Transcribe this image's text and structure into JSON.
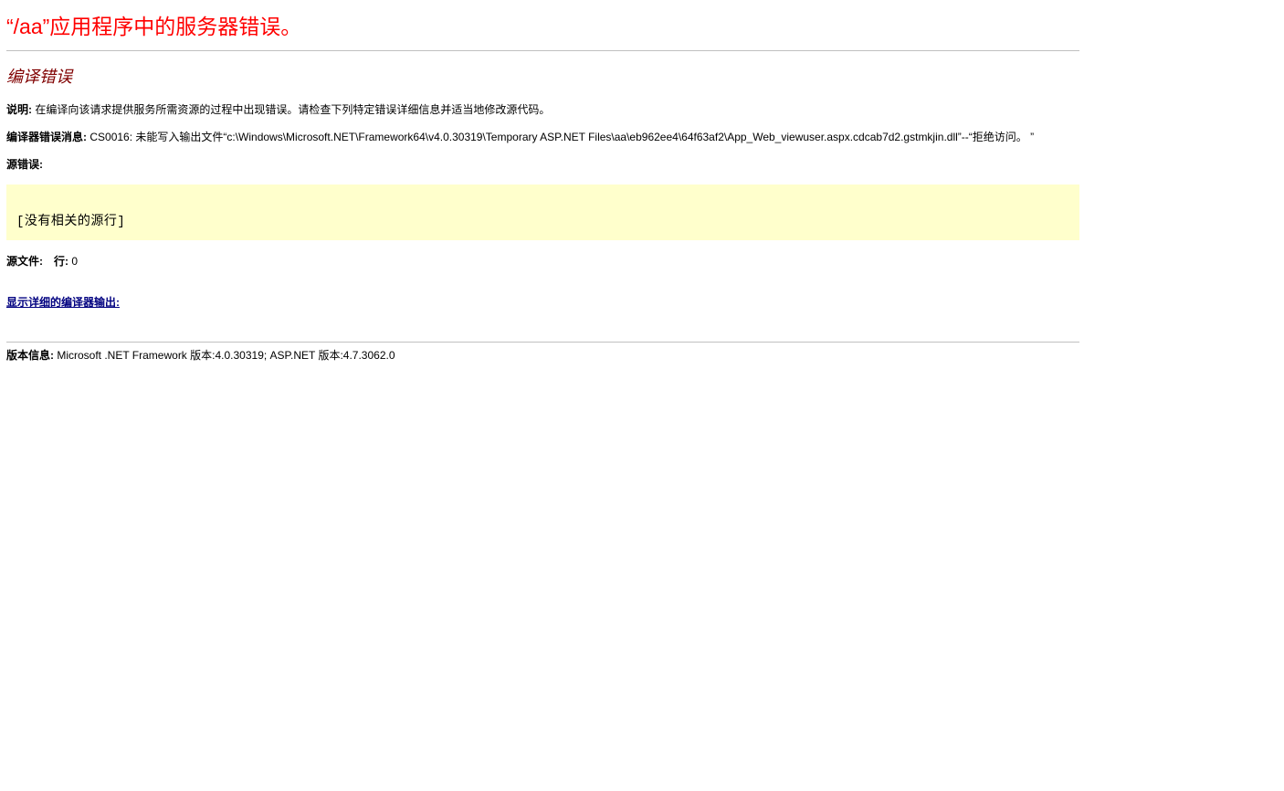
{
  "page": {
    "title": "“/aa”应用程序中的服务器错误。"
  },
  "error": {
    "heading": "编译错误",
    "description_label": "说明:",
    "description_text": "在编译向该请求提供服务所需资源的过程中出现错误。请检查下列特定错误详细信息并适当地修改源代码。",
    "compiler_message_label": "编译器错误消息:",
    "compiler_message_text": "CS0016: 未能写入输出文件“c:\\Windows\\Microsoft.NET\\Framework64\\v4.0.30319\\Temporary ASP.NET Files\\aa\\eb962ee4\\64f63af2\\App_Web_viewuser.aspx.cdcab7d2.gstmkjin.dll”--“拒绝访问。 ”",
    "source_error_label": "源错误:",
    "source_box_text": "[没有相关的源行]",
    "source_file_label": "源文件:",
    "line_label": "行:",
    "line_value": "0",
    "detail_link": "显示详细的编译器输出:"
  },
  "version": {
    "label": "版本信息:",
    "text": "Microsoft .NET Framework 版本:4.0.30319; ASP.NET 版本:4.7.3062.0"
  },
  "colors": {
    "title": "#ff0000",
    "heading": "#800000",
    "source_box_bg": "#ffffcc",
    "link": "#000080",
    "rule": "#c0c0c0"
  }
}
